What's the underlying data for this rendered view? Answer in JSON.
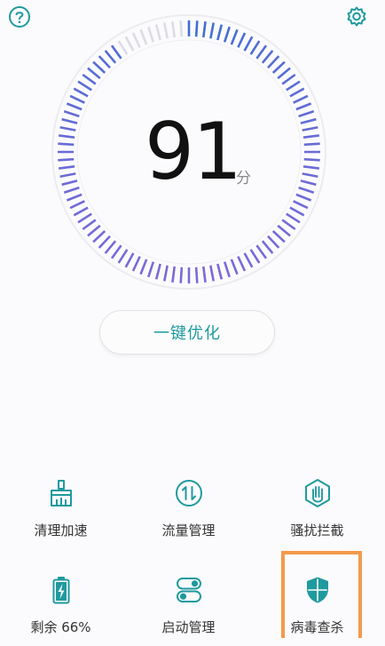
{
  "score": {
    "value": "91",
    "unit": "分",
    "level": 0.91
  },
  "optimize_button": {
    "label": "一键优化"
  },
  "tools": [
    {
      "label": "清理加速",
      "icon": "broom-icon"
    },
    {
      "label": "流量管理",
      "icon": "data-traffic-icon"
    },
    {
      "label": "骚扰拦截",
      "icon": "block-hand-icon"
    },
    {
      "label": "剩余 66%",
      "icon": "battery-icon"
    },
    {
      "label": "启动管理",
      "icon": "toggle-switch-icon"
    },
    {
      "label": "病毒查杀",
      "icon": "shield-icon"
    }
  ],
  "colors": {
    "accent": "#1f9a9e",
    "gauge_blue": "#3f6fd1",
    "gauge_purple": "#7a6ad8",
    "highlight": "#f39a4b"
  }
}
